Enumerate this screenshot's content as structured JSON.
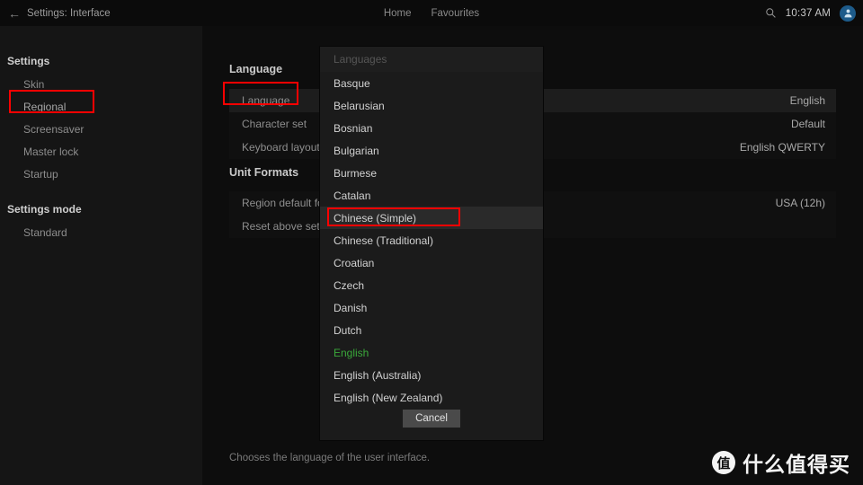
{
  "topbar": {
    "back_icon": "arrow-left-icon",
    "title": "Settings: Interface",
    "nav": [
      "Home",
      "Favourites"
    ],
    "search_icon": "search-icon",
    "clock": "10:37 AM",
    "avatar_icon": "user-avatar-icon"
  },
  "sidebar": {
    "groups": [
      {
        "label": "Settings",
        "items": [
          {
            "label": "Skin",
            "highlighted": false
          },
          {
            "label": "Regional",
            "highlighted": true
          },
          {
            "label": "Screensaver",
            "highlighted": false
          },
          {
            "label": "Master lock",
            "highlighted": false
          },
          {
            "label": "Startup",
            "highlighted": false
          }
        ]
      },
      {
        "label": "Settings mode",
        "items": [
          {
            "label": "Standard",
            "highlighted": false
          }
        ]
      }
    ]
  },
  "main": {
    "sections": [
      {
        "title": "Language",
        "rows": [
          {
            "label": "Language",
            "value": "English",
            "active": true
          },
          {
            "label": "Character set",
            "value": "Default",
            "active": false
          },
          {
            "label": "Keyboard layouts",
            "value": "English QWERTY",
            "active": false
          }
        ]
      },
      {
        "title": "Unit Formats",
        "rows": [
          {
            "label": "Region default format",
            "value": "USA (12h)",
            "active": false
          },
          {
            "label": "Reset above settings to default",
            "value": "",
            "active": false
          }
        ]
      }
    ],
    "hint": "Chooses the language of the user interface."
  },
  "dialog": {
    "header": "Languages",
    "items": [
      {
        "label": "Basque",
        "state": "normal"
      },
      {
        "label": "Belarusian",
        "state": "normal"
      },
      {
        "label": "Bosnian",
        "state": "normal"
      },
      {
        "label": "Bulgarian",
        "state": "normal"
      },
      {
        "label": "Burmese",
        "state": "normal"
      },
      {
        "label": "Catalan",
        "state": "normal"
      },
      {
        "label": "Chinese (Simple)",
        "state": "focused"
      },
      {
        "label": "Chinese (Traditional)",
        "state": "normal"
      },
      {
        "label": "Croatian",
        "state": "normal"
      },
      {
        "label": "Czech",
        "state": "normal"
      },
      {
        "label": "Danish",
        "state": "normal"
      },
      {
        "label": "Dutch",
        "state": "normal"
      },
      {
        "label": "English",
        "state": "current"
      },
      {
        "label": "English (Australia)",
        "state": "normal"
      },
      {
        "label": "English (New Zealand)",
        "state": "normal"
      }
    ],
    "cancel_label": "Cancel"
  },
  "annotations": {
    "color": "#fe0000",
    "boxes": [
      "sidebar-regional",
      "setting-row-language",
      "dialog-item-chinese-simple"
    ]
  },
  "watermark": {
    "logo_glyph": "值",
    "text": "什么值得买"
  },
  "colors": {
    "app_background": "#0d0d0d",
    "sidebar_background": "#151515",
    "dialog_background": "#1b1b1b",
    "row_background": "#101010",
    "row_active_background": "#1d1d1d",
    "selected_language": "#3aa93a",
    "annotation_red": "#fe0000",
    "avatar_blue": "#1d5b8a"
  }
}
